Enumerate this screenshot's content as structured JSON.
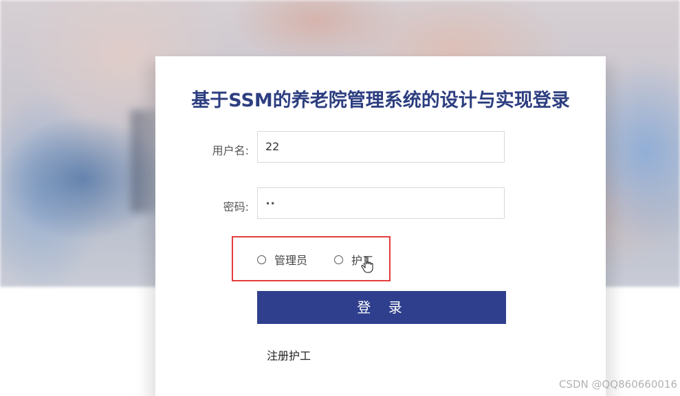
{
  "login": {
    "title": "基于SSM的养老院管理系统的设计与实现登录",
    "username_label": "用户名:",
    "username_value": "22",
    "password_label": "密码:",
    "password_display": "••",
    "roles": [
      {
        "label": "管理员",
        "selected": false
      },
      {
        "label": "护工",
        "selected": false
      }
    ],
    "login_button": "登 录",
    "register_link": "注册护工"
  },
  "watermark": "CSDN @QQ860660016",
  "colors": {
    "title": "#2d3e80",
    "button": "#2f3f8d",
    "highlight_box": "#e33b3b"
  }
}
